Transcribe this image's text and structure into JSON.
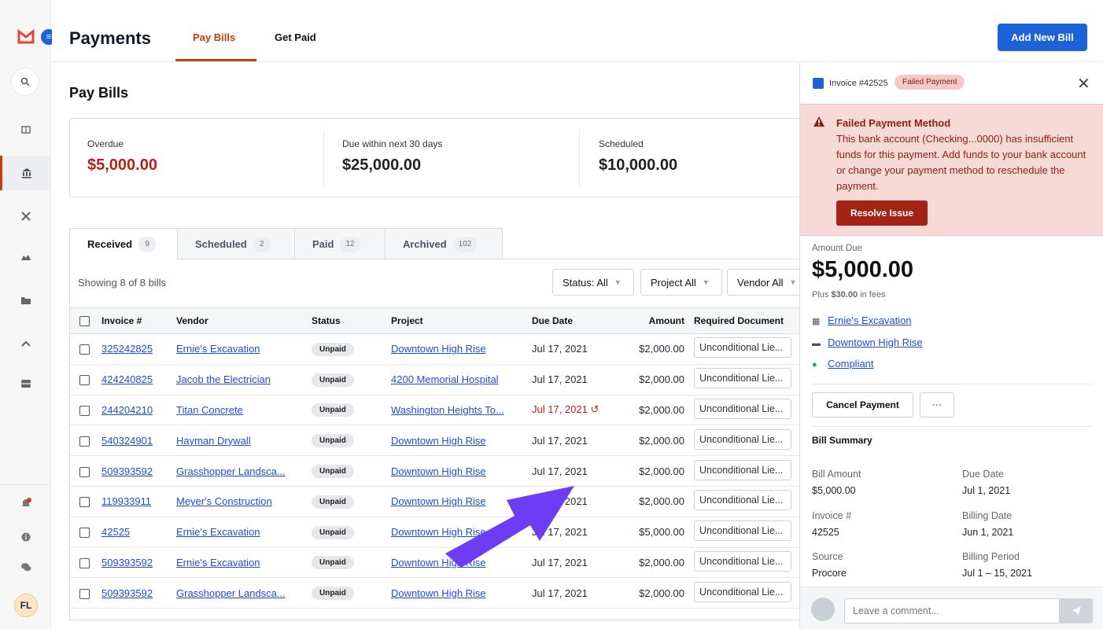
{
  "app": {
    "title": "Payments",
    "add_button": "Add New Bill"
  },
  "top_tabs": [
    {
      "label": "Pay Bills"
    },
    {
      "label": "Get Paid"
    }
  ],
  "user": {
    "initials": "FL"
  },
  "page": {
    "title": "Pay Bills"
  },
  "summary": [
    {
      "label": "Overdue",
      "value": "$5,000.00"
    },
    {
      "label": "Due within next 30 days",
      "value": "$25,000.00"
    },
    {
      "label": "Scheduled",
      "value": "$10,000.00"
    }
  ],
  "bill_tabs": [
    {
      "label": "Received",
      "count": "9"
    },
    {
      "label": "Scheduled",
      "count": "2"
    },
    {
      "label": "Paid",
      "count": "12"
    },
    {
      "label": "Archived",
      "count": "102"
    }
  ],
  "list": {
    "showing": "Showing 8 of 8 bills",
    "filters": [
      {
        "label": "Status: All"
      },
      {
        "label": "Project All"
      },
      {
        "label": "Vendor All"
      }
    ],
    "columns": [
      "Invoice #",
      "Vendor",
      "Status",
      "Project",
      "Due Date",
      "Amount",
      "Required Document"
    ],
    "rows": [
      {
        "invoice": "325242825",
        "vendor": "Ernie's Excavation",
        "status": "Unpaid",
        "project": "Downtown High Rise",
        "due": "Jul 17, 2021",
        "amount": "$2,000.00",
        "doc": "Unconditional Lie..."
      },
      {
        "invoice": "424240825",
        "vendor": "Jacob the Electrician",
        "status": "Unpaid",
        "project": "4200 Memorial Hospital",
        "due": "Jul 17, 2021",
        "amount": "$2,000.00",
        "doc": "Unconditional Lie..."
      },
      {
        "invoice": "244204210",
        "vendor": "Titan Concrete",
        "status": "Unpaid",
        "project": "Washington Heights To...",
        "due": "Jul 17, 2021",
        "amount": "$2,000.00",
        "doc": "Unconditional Lie..."
      },
      {
        "invoice": "540324901",
        "vendor": "Hayman Drywall",
        "status": "Unpaid",
        "project": "Downtown High Rise",
        "due": "Jul 17, 2021",
        "amount": "$2,000.00",
        "doc": "Unconditional Lie..."
      },
      {
        "invoice": "509393592",
        "vendor": "Grasshopper Landsca...",
        "status": "Unpaid",
        "project": "Downtown High Rise",
        "due": "Jul 17, 2021",
        "amount": "$2,000.00",
        "doc": "Unconditional Lie..."
      },
      {
        "invoice": "119933911",
        "vendor": "Meyer's Construction",
        "status": "Unpaid",
        "project": "Downtown High Rise",
        "due": "Jul 17, 2021",
        "amount": "$2,000.00",
        "doc": "Unconditional Lie..."
      },
      {
        "invoice": "42525",
        "vendor": "Ernie's Excavation",
        "status": "Unpaid",
        "project": "Downtown High Rise",
        "due": "Jul 17, 2021",
        "amount": "$5,000.00",
        "doc": "Unconditional Lie..."
      },
      {
        "invoice": "509393592",
        "vendor": "Ernie's Excavation",
        "status": "Unpaid",
        "project": "Downtown High Rise",
        "due": "Jul 17, 2021",
        "amount": "$2,000.00",
        "doc": "Unconditional Lie..."
      },
      {
        "invoice": "509393592",
        "vendor": "Grasshopper Landsca...",
        "status": "Unpaid",
        "project": "Downtown High Rise",
        "due": "Jul 17, 2021",
        "amount": "$2,000.00",
        "doc": "Unconditional Lie..."
      }
    ]
  },
  "detail": {
    "invoice_title": "Invoice #42525",
    "status_badge": "Failed Payment",
    "alert_title": "Failed Payment Method",
    "alert_body": "This bank account (Checking...0000) has insufficient funds for this payment. Add funds to your bank account or change your payment method to reschedule the payment.",
    "resolve_button": "Resolve Issue",
    "amount_due_label": "Amount Due",
    "amount_due": "$5,000.00",
    "fees_prefix": "Plus ",
    "fees_amount": "$30.00",
    "fees_suffix": " in fees",
    "vendor_link": "Ernie's Excavation",
    "project_link": "Downtown High Rise",
    "compliance_link": "Compliant",
    "cancel_button": "Cancel Payment",
    "more_button": "···",
    "bill_summary_title": "Bill Summary",
    "fields": {
      "bill_amount_label": "Bill Amount",
      "bill_amount": "$5,000.00",
      "due_date_label": "Due Date",
      "due_date": "Jul 1, 2021",
      "invoice_label": "Invoice #",
      "invoice": "42525",
      "billing_date_label": "Billing Date",
      "billing_date": "Jun 1, 2021",
      "source_label": "Source",
      "source": "Procore",
      "billing_period_label": "Billing Period",
      "billing_period": "Jul 1 – 15, 2021"
    },
    "comment_placeholder": "Leave a comment..."
  },
  "colors": {
    "accent": "#c2410c",
    "primary": "#1d62d6",
    "danger": "#b4231b",
    "alert_bg": "#f7d9d5",
    "annotation_arrow": "#6d3df5"
  },
  "icons": [
    "procore-logo-icon",
    "document-icon",
    "search-icon",
    "dashboard-icon",
    "bank-icon",
    "tools-icon",
    "building-icon",
    "folder-icon",
    "chevron-up-icon",
    "inbox-icon",
    "bell-icon",
    "info-icon",
    "chat-icon",
    "close-icon",
    "warning-icon",
    "send-icon"
  ]
}
